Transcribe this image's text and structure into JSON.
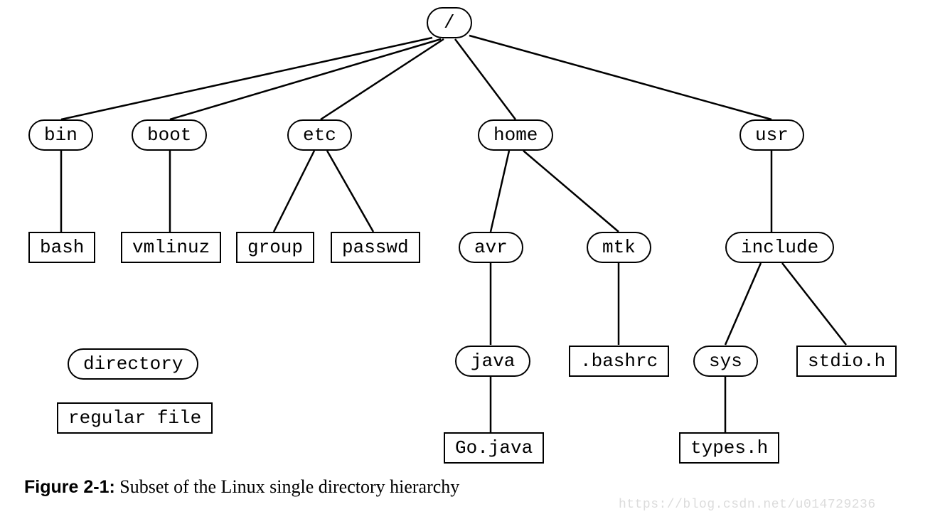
{
  "tree": {
    "root": {
      "label": "/",
      "type": "dir"
    },
    "level1": {
      "bin": {
        "label": "bin",
        "type": "dir"
      },
      "boot": {
        "label": "boot",
        "type": "dir"
      },
      "etc": {
        "label": "etc",
        "type": "dir"
      },
      "home": {
        "label": "home",
        "type": "dir"
      },
      "usr": {
        "label": "usr",
        "type": "dir"
      }
    },
    "level2": {
      "bash": {
        "label": "bash",
        "type": "file",
        "parent": "bin"
      },
      "vmlinuz": {
        "label": "vmlinuz",
        "type": "file",
        "parent": "boot"
      },
      "group": {
        "label": "group",
        "type": "file",
        "parent": "etc"
      },
      "passwd": {
        "label": "passwd",
        "type": "file",
        "parent": "etc"
      },
      "avr": {
        "label": "avr",
        "type": "dir",
        "parent": "home"
      },
      "mtk": {
        "label": "mtk",
        "type": "dir",
        "parent": "home"
      },
      "include": {
        "label": "include",
        "type": "dir",
        "parent": "usr"
      }
    },
    "level3": {
      "java": {
        "label": "java",
        "type": "dir",
        "parent": "avr"
      },
      "bashrc": {
        "label": ".bashrc",
        "type": "file",
        "parent": "mtk"
      },
      "sys": {
        "label": "sys",
        "type": "dir",
        "parent": "include"
      },
      "stdioh": {
        "label": "stdio.h",
        "type": "file",
        "parent": "include"
      }
    },
    "level4": {
      "gojava": {
        "label": "Go.java",
        "type": "file",
        "parent": "java"
      },
      "typesh": {
        "label": "types.h",
        "type": "file",
        "parent": "sys"
      }
    }
  },
  "legend": {
    "directory": "directory",
    "file": "regular file"
  },
  "caption": {
    "figure_label": "Figure 2-1:",
    "text": " Subset of the Linux single directory hierarchy"
  },
  "watermark": "https://blog.csdn.net/u014729236"
}
